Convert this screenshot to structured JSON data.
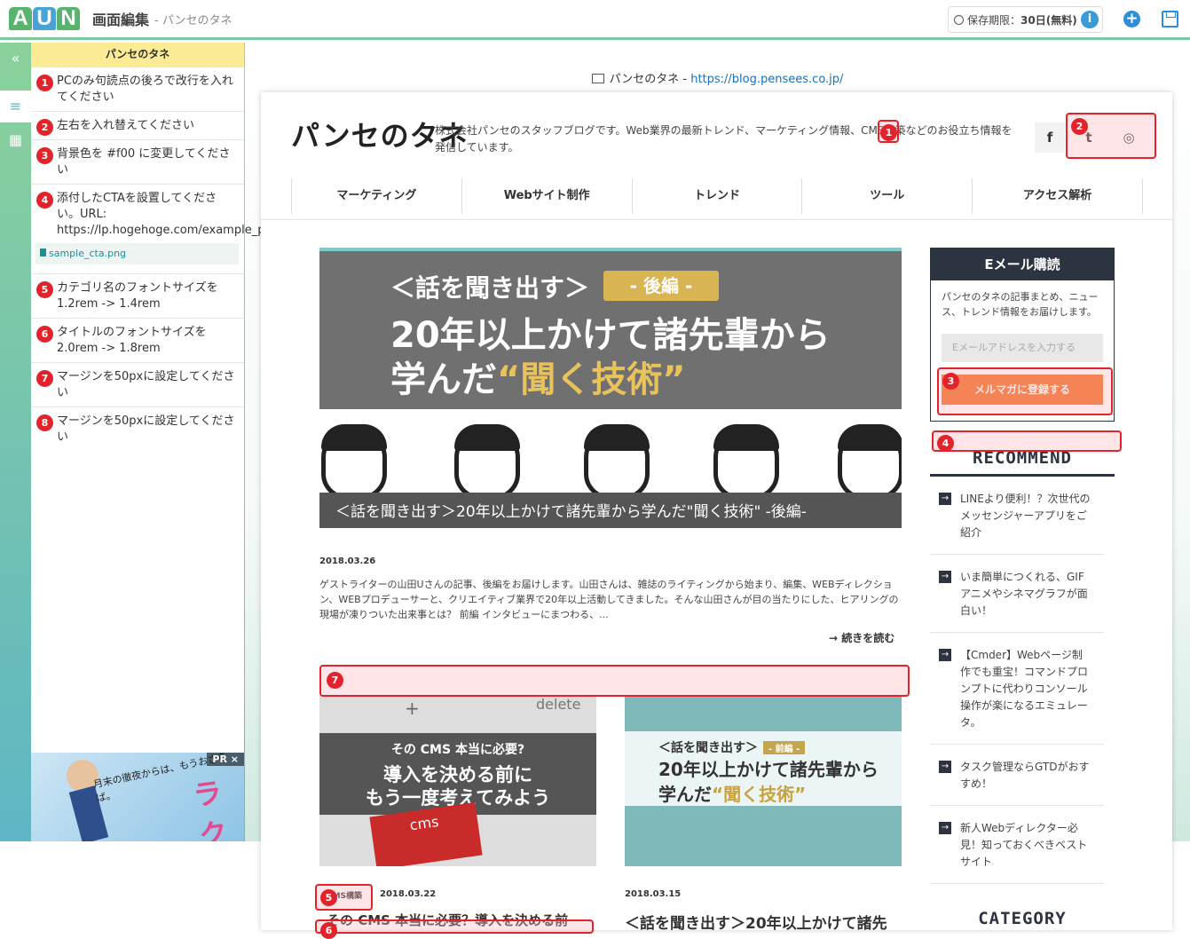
{
  "app": {
    "logo_letters": [
      "A",
      "U",
      "N"
    ],
    "logo_colors": [
      "#59b36f",
      "#4aa3d6",
      "#59b36f"
    ],
    "title": "画面編集",
    "subtitle": "- パンセのタネ",
    "period_label": "保存期限：",
    "period_value": "30日(無料)",
    "info_icon": "i",
    "plus_icon": "+"
  },
  "rail": {
    "collapse": "«",
    "list": "≡",
    "grid": "▦"
  },
  "panel": {
    "heading": "パンセのタネ",
    "tasks": [
      {
        "n": "1",
        "text": "PCのみ句読点の後ろで改行を入れてください"
      },
      {
        "n": "2",
        "text": "左右を入れ替えてください"
      },
      {
        "n": "3",
        "text": "背景色を #f00 に変更してください"
      },
      {
        "n": "4",
        "text": "添付したCTAを設置してください。URL: https://lp.hogehoge.com/example_page/",
        "attachment": "sample_cta.png"
      },
      {
        "n": "5",
        "text": "カテゴリ名のフォントサイズを1.2rem -> 1.4rem"
      },
      {
        "n": "6",
        "text": "タイトルのフォントサイズを2.0rem -> 1.8rem"
      },
      {
        "n": "7",
        "text": "マージンを50pxに設定してください"
      },
      {
        "n": "8",
        "text": "マージンを50pxに設定してください"
      }
    ],
    "pr_tag": "PR ×",
    "pr_text1": "月末の徹夜からは、もうおさらば。",
    "pr_text2": "ラクスト"
  },
  "preview": {
    "site_name": "パンセのタネ",
    "separator": " - ",
    "url": "https://blog.pensees.co.jp/"
  },
  "site": {
    "logo": "パンセのタネ",
    "description": "株式会社パンセのスタッフブログです。Web業界の最新トレンド、マーケティング情報、CMS構築などのお役立ち情報を発信しています。",
    "social": {
      "facebook": "f",
      "twitter": "t",
      "instagram": "◎"
    },
    "nav": [
      "マーケティング",
      "Webサイト制作",
      "トレンド",
      "ツール",
      "アクセス解析"
    ],
    "hero": {
      "sub": "＜話を聞き出す＞",
      "tag": "- 後編 -",
      "line1": "20年以上かけて諸先輩から",
      "line2_a": "学んだ",
      "line2_b": "“聞く技術”",
      "caption": "＜話を聞き出す＞20年以上かけて諸先輩から学んだ\"聞く技術\" -後編-"
    },
    "post": {
      "date": "2018.03.26",
      "excerpt": "ゲストライターの山田Uさんの記事、後編をお届けします。山田さんは、雑誌のライティングから始まり、編集、WEBディレクション、WEBプロデューサーと、クリエイティブ業界で20年以上活動してきました。そんな山田さんが目の当たりにした、ヒアリングの現場が凍りついた出来事とは？ 前編 インタビューにまつわる、...",
      "readmore": "→  続きを読む"
    },
    "card1": {
      "key_top": "+",
      "key_right": "delete",
      "line1": "その CMS 本当に必要?",
      "line2": "導入を決める前に",
      "line3": "もう一度考えてみよう",
      "key_text": "cms",
      "category": "CMS構築",
      "date": "2018.03.22",
      "title": "その CMS 本当に必要？導入を決める前"
    },
    "card2": {
      "line1": "＜話を聞き出す＞",
      "tag": "- 前編 -",
      "line2": "20年以上かけて諸先輩から",
      "line3_a": "学んだ",
      "line3_b": "“聞く技術”",
      "date": "2018.03.15",
      "title": "＜話を聞き出す＞20年以上かけて諸先"
    },
    "sidebar": {
      "mail_head": "Eメール購読",
      "mail_desc": "パンセのタネの記事まとめ、ニュース、トレンド情報をお届けします。",
      "mail_placeholder": "Eメールアドレスを入力する",
      "mail_button": "メルマガに登録する",
      "recommend_head": "RECOMMEND",
      "recommend": [
        "LINEより便利！？次世代のメッセンジャーアプリをご紹介",
        "いま簡単につくれる、GIFアニメやシネマグラフが面白い！",
        "【Cmder】Webページ制作でも重宝！コマンドプロンプトに代わりコンソール操作が楽になるエミュレータ。",
        "タスク管理ならGTDがおすすめ！",
        "新人Webディレクター必見！知っておくべきベストサイト"
      ],
      "category_head": "CATEGORY"
    }
  },
  "markers": [
    "1",
    "2",
    "3",
    "4",
    "5",
    "6",
    "7"
  ]
}
